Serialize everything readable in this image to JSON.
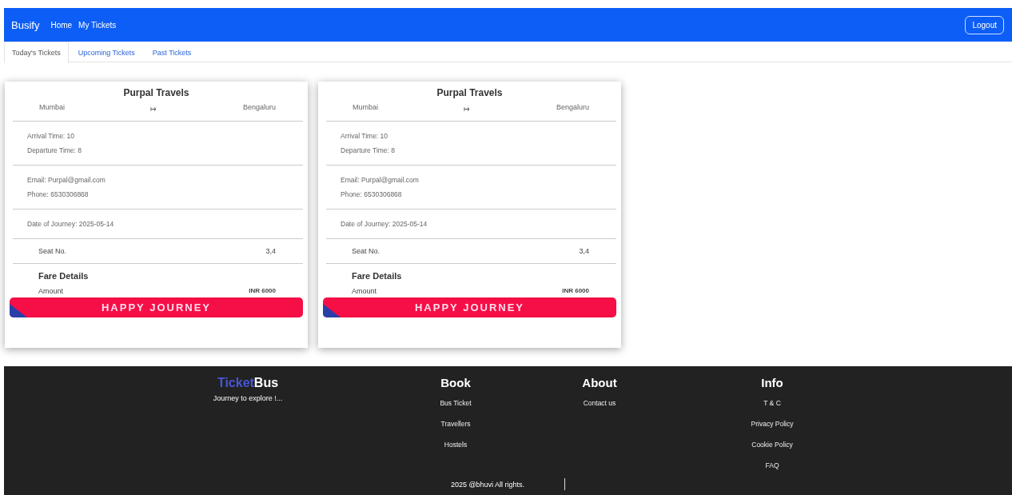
{
  "navbar": {
    "brand": "Busify",
    "links": [
      "Home",
      "My Tickets"
    ],
    "logout": "Logout"
  },
  "tabs": [
    {
      "label": "Today's Tickets",
      "selected": true
    },
    {
      "label": "Upcoming Tickets",
      "selected": false
    },
    {
      "label": "Past Tickets",
      "selected": false
    }
  ],
  "tickets": [
    {
      "operator": "Purpal Travels",
      "from": "Mumbai",
      "arrow": "↦",
      "to": "Bengaluru",
      "arrival": "Arrival Time: 10",
      "departure": "Departure Time: 8",
      "email": "Email: Purpal@gmail.com",
      "phone": "Phone: 6530306868",
      "date": "Date of Journey: 2025-05-14",
      "seat_label": "Seat No.",
      "seat": "3,4",
      "fare_heading": "Fare Details",
      "amount_label": "Amount",
      "amount": "INR 6000",
      "banner": "HAPPY JOURNEY"
    },
    {
      "operator": "Purpal Travels",
      "from": "Mumbai",
      "arrow": "↦",
      "to": "Bengaluru",
      "arrival": "Arrival Time: 10",
      "departure": "Departure Time: 8",
      "email": "Email: Purpal@gmail.com",
      "phone": "Phone: 6530306868",
      "date": "Date of Journey: 2025-05-14",
      "seat_label": "Seat No.",
      "seat": "3,4",
      "fare_heading": "Fare Details",
      "amount_label": "Amount",
      "amount": "INR 6000",
      "banner": "HAPPY JOURNEY"
    }
  ],
  "footer": {
    "brand_first": "Ticket",
    "brand_second": "Bus",
    "tagline": "Journey to explore !...",
    "columns": [
      {
        "heading": "Book",
        "links": [
          "Bus Ticket",
          "Travellers",
          "Hostels"
        ]
      },
      {
        "heading": "About",
        "links": [
          "Contact us"
        ]
      },
      {
        "heading": "Info",
        "links": [
          "T & C",
          "Privacy Policy",
          "Cookie Policy",
          "FAQ"
        ]
      }
    ],
    "copyright": "2025 @bhuvi All rights."
  }
}
